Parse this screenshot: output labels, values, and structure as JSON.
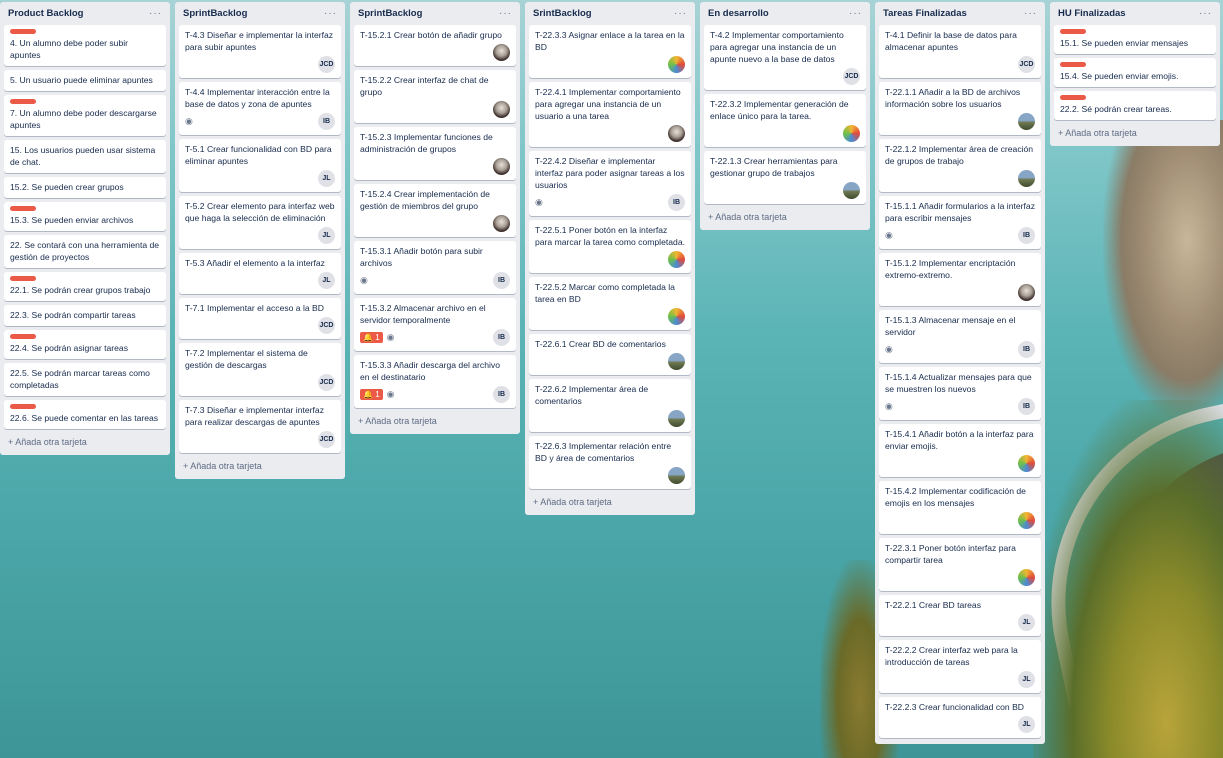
{
  "lists": [
    {
      "title": "Product Backlog",
      "add_label": "+ Añada otra tarjeta",
      "cards": [
        {
          "text": "4. Un alumno debe poder subir apuntes",
          "label": true
        },
        {
          "text": "5. Un usuario puede eliminar apuntes"
        },
        {
          "text": "7. Un alumno debe poder descargarse apuntes",
          "label": true
        },
        {
          "text": "15. Los usuarios pueden usar sistema de chat."
        },
        {
          "text": "15.2. Se pueden crear grupos"
        },
        {
          "text": "15.3. Se pueden enviar archivos",
          "label": true
        },
        {
          "text": "22. Se contará con una herramienta de gestión de proyectos"
        },
        {
          "text": "22.1. Se podrán crear grupos trabajo",
          "label": true
        },
        {
          "text": "22.3. Se podrán compartir tareas"
        },
        {
          "text": "22.4. Se podrán asignar tareas",
          "label": true
        },
        {
          "text": "22.5. Se podrán marcar tareas como completadas"
        },
        {
          "text": "22.6. Se puede comentar en las tareas",
          "label": true
        }
      ]
    },
    {
      "title": "SprintBacklog",
      "add_label": "+ Añada otra tarjeta",
      "cards": [
        {
          "text": "T-4.3 Diseñar e implementar la interfaz para subir apuntes",
          "avatar": "JCD"
        },
        {
          "text": "T-4.4 Implementar interacción entre la base de datos y zona de apuntes",
          "avatar": "IB",
          "eye": true
        },
        {
          "text": "T-5.1 Crear funcionalidad con BD para eliminar apuntes",
          "avatar": "JL"
        },
        {
          "text": "T-5.2 Crear elemento para interfaz web que haga la selección de eliminación",
          "avatar": "JL"
        },
        {
          "text": "T-5.3 Añadir el elemento a la interfaz",
          "avatar": "JL"
        },
        {
          "text": "T-7.1 Implementar el acceso a la BD",
          "avatar": "JCD"
        },
        {
          "text": "T-7.2 Implementar el sistema de gestión de descargas",
          "avatar": "JCD"
        },
        {
          "text": "T-7.3 Diseñar e implementar interfaz para realizar descargas de apuntes",
          "avatar": "JCD"
        }
      ]
    },
    {
      "title": "SprintBacklog",
      "add_label": "+ Añada otra tarjeta",
      "cards": [
        {
          "text": "T-15.2.1 Crear botón de añadir grupo",
          "avatar_photo": "cat"
        },
        {
          "text": "T-15.2.2 Crear interfaz de chat de grupo",
          "avatar_photo": "cat"
        },
        {
          "text": "T-15.2.3 Implementar funciones de administración de grupos",
          "avatar_photo": "cat"
        },
        {
          "text": "T-15.2.4 Crear implementación de gestión de miembros del grupo",
          "avatar_photo": "cat"
        },
        {
          "text": "T-15.3.1 Añadir botón para subir archivos",
          "avatar": "IB",
          "eye": true
        },
        {
          "text": "T-15.3.2 Almacenar archivo en el servidor temporalmente",
          "avatar": "IB",
          "eye": true,
          "alert": "1"
        },
        {
          "text": "T-15.3.3 Añadir descarga del archivo en el destinatario",
          "avatar": "IB",
          "eye": true,
          "alert": "1"
        }
      ]
    },
    {
      "title": "SrintBacklog",
      "add_label": "+ Añada otra tarjeta",
      "cards": [
        {
          "text": "T-22.3.3 Asignar enlace a la tarea en la BD",
          "avatar_photo": "color"
        },
        {
          "text": "T-22.4.1 Implementar comportamiento para agregar una instancia de un usuario a una tarea",
          "avatar_photo": "cat"
        },
        {
          "text": "T-22.4.2 Diseñar e implementar interfaz para poder asignar tareas a los usuarios",
          "avatar": "IB",
          "eye": true
        },
        {
          "text": "T-22.5.1 Poner botón en la interfaz para marcar la tarea como completada.",
          "avatar_photo": "color"
        },
        {
          "text": "T-22.5.2 Marcar como completada la tarea en BD",
          "avatar_photo": "color"
        },
        {
          "text": "T-22.6.1 Crear BD de comentarios",
          "avatar_photo": "land"
        },
        {
          "text": "T-22.6.2 Implementar área de comentarios",
          "avatar_photo": "land"
        },
        {
          "text": "T-22.6.3 Implementar relación entre BD y área de comentarios",
          "avatar_photo": "land"
        }
      ]
    },
    {
      "title": "En desarrollo",
      "add_label": "+ Añada otra tarjeta",
      "cards": [
        {
          "text": "T-4.2 Implementar comportamiento para agregar una instancia de un apunte nuevo a la base de datos",
          "avatar": "JCD"
        },
        {
          "text": "T-22.3.2 Implementar generación de enlace único para la tarea.",
          "avatar_photo": "color"
        },
        {
          "text": "T-22.1.3 Crear herramientas para gestionar grupo de trabajos",
          "avatar_photo": "land"
        }
      ]
    },
    {
      "title": "Tareas Finalizadas",
      "add_label": "",
      "cards": [
        {
          "text": "T-4.1 Definir la base de datos para almacenar apuntes",
          "avatar": "JCD"
        },
        {
          "text": "T-22.1.1 Añadir a la BD de archivos información sobre los usuarios",
          "avatar_photo": "land"
        },
        {
          "text": "T-22.1.2 Implementar área de creación de grupos de trabajo",
          "avatar_photo": "land"
        },
        {
          "text": "T-15.1.1 Añadir formularios a la interfaz para escribir mensajes",
          "avatar": "IB",
          "eye": true
        },
        {
          "text": "T-15.1.2 Implementar encriptación extremo-extremo.",
          "avatar_photo": "cat"
        },
        {
          "text": "T-15.1.3 Almacenar mensaje en el servidor",
          "avatar": "IB",
          "eye": true
        },
        {
          "text": "T-15.1.4 Actualizar mensajes para que se muestren los nuevos",
          "avatar": "IB",
          "eye": true
        },
        {
          "text": "T-15.4.1 Añadir botón a la interfaz para enviar emojis.",
          "avatar_photo": "color"
        },
        {
          "text": "T-15.4.2 Implementar codificación de emojis en los mensajes",
          "avatar_photo": "color"
        },
        {
          "text": "T-22.3.1 Poner botón interfaz para compartir tarea",
          "avatar_photo": "color"
        },
        {
          "text": "T-22.2.1 Crear BD tareas",
          "avatar": "JL"
        },
        {
          "text": "T-22.2.2 Crear interfaz web para la introducción de tareas",
          "avatar": "JL"
        },
        {
          "text": "T-22.2.3 Crear funcionalidad con BD",
          "avatar": "JL"
        }
      ]
    },
    {
      "title": "HU Finalizadas",
      "add_label": "+ Añada otra tarjeta",
      "cards": [
        {
          "text": "15.1. Se pueden enviar mensajes",
          "label": true
        },
        {
          "text": "15.4. Se pueden enviar emojis.",
          "label": true
        },
        {
          "text": "22.2. Sé podrán crear tareas.",
          "label": true
        }
      ]
    }
  ],
  "icons": {
    "menu": "···",
    "eye": "◉",
    "alert": "🔔"
  }
}
